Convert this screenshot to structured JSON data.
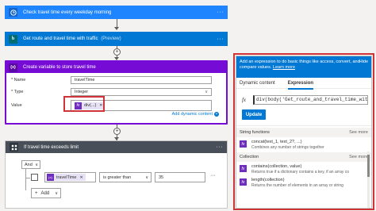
{
  "steps": {
    "recurrence": {
      "title": "Check travel time every weekday morning"
    },
    "bing": {
      "title": "Get route and travel time with traffic",
      "preview": "(Preview)"
    },
    "variable": {
      "title": "Create variable to store travel time",
      "name_label": "* Name",
      "name_value": "travelTime",
      "type_label": "* Type",
      "type_value": "Integer",
      "value_label": "Value",
      "value_token": "div(...)",
      "add_dynamic": "Add dynamic content"
    },
    "condition": {
      "title": "If travel time exceeds limit",
      "and_label": "And",
      "token": "travelTime",
      "operator": "is greater than",
      "compare_value": "35",
      "add_label": "Add"
    }
  },
  "panel": {
    "banner_text": "Add an expression to do basic things like access, convert, and compare values.",
    "learn_more": "Learn more",
    "hide": "Hide",
    "tabs": [
      "Dynamic content",
      "Expression"
    ],
    "expression": "div(body('Get_route_and_travel_time_with_t",
    "update_label": "Update",
    "sections": [
      {
        "title": "String functions",
        "see_more": "See more",
        "items": [
          {
            "name": "concat(text_1, text_2?, ...)",
            "desc": "Combines any number of strings together"
          }
        ]
      },
      {
        "title": "Collection",
        "see_more": "See more",
        "items": [
          {
            "name": "contains(collection, value)",
            "desc": "Returns true if a dictionary contains a key, if an array co"
          },
          {
            "name": "length(collection)",
            "desc": "Returns the number of elements in an array or string"
          }
        ]
      }
    ]
  },
  "icons": {
    "recurrence": "clock-icon",
    "bing": "bing-icon",
    "variable": "variable-icon",
    "condition": "condition-icon"
  },
  "colors": {
    "recurrence": "#1f85ff",
    "bing": "#0078d4",
    "variable": "#770bd6",
    "condition": "#484f58",
    "highlight": "#d13438"
  }
}
